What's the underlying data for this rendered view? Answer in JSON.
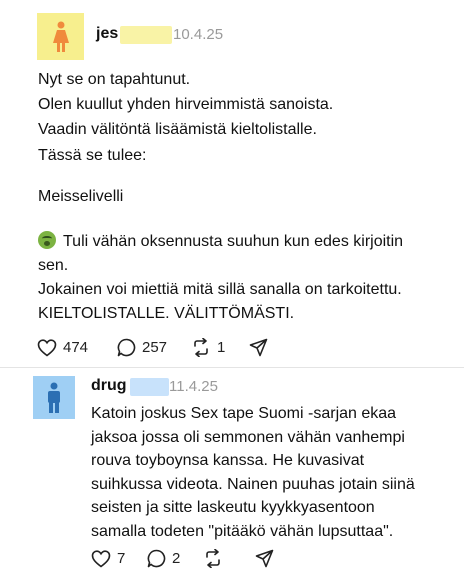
{
  "post1": {
    "username": "jes",
    "date": "10.4.25",
    "avatar_icon": "woman-icon",
    "avatar_color": "#f7ef8e",
    "lines": [
      "Nyt se on tapahtunut.",
      "Olen kuullut yhden hirveimmistä sanoista.",
      "Vaadin välitöntä lisäämistä kieltolistalle.",
      "Tässä se tulee:",
      "Meisselivelli",
      "Tuli vähän oksennusta suuhun kun edes kirjoitin",
      "sen.",
      "Jokainen voi miettiä mitä sillä sanalla on tarkoitettu.",
      "KIELTOLISTALLE. VÄLITTÖMÄSTI."
    ],
    "emoji": "sick-face-icon",
    "likes": "474",
    "replies": "257",
    "quotes": "1"
  },
  "post2": {
    "username": "drug",
    "date": "11.4.25",
    "avatar_icon": "man-icon",
    "avatar_color": "#9fcff4",
    "lines": [
      "Katoin joskus Sex tape Suomi -sarjan ekaa",
      "jaksoa jossa oli semmonen vähän vanhempi",
      "rouva toyboynsa kanssa. He kuvasivat",
      "suihkussa videota. Nainen puuhas jotain siinä",
      "seisten ja sitte laskeutu kyykkyasentoon",
      "samalla todeten \"pitääkö vähän lupsuttaa\"."
    ],
    "likes": "7",
    "replies": "2"
  }
}
